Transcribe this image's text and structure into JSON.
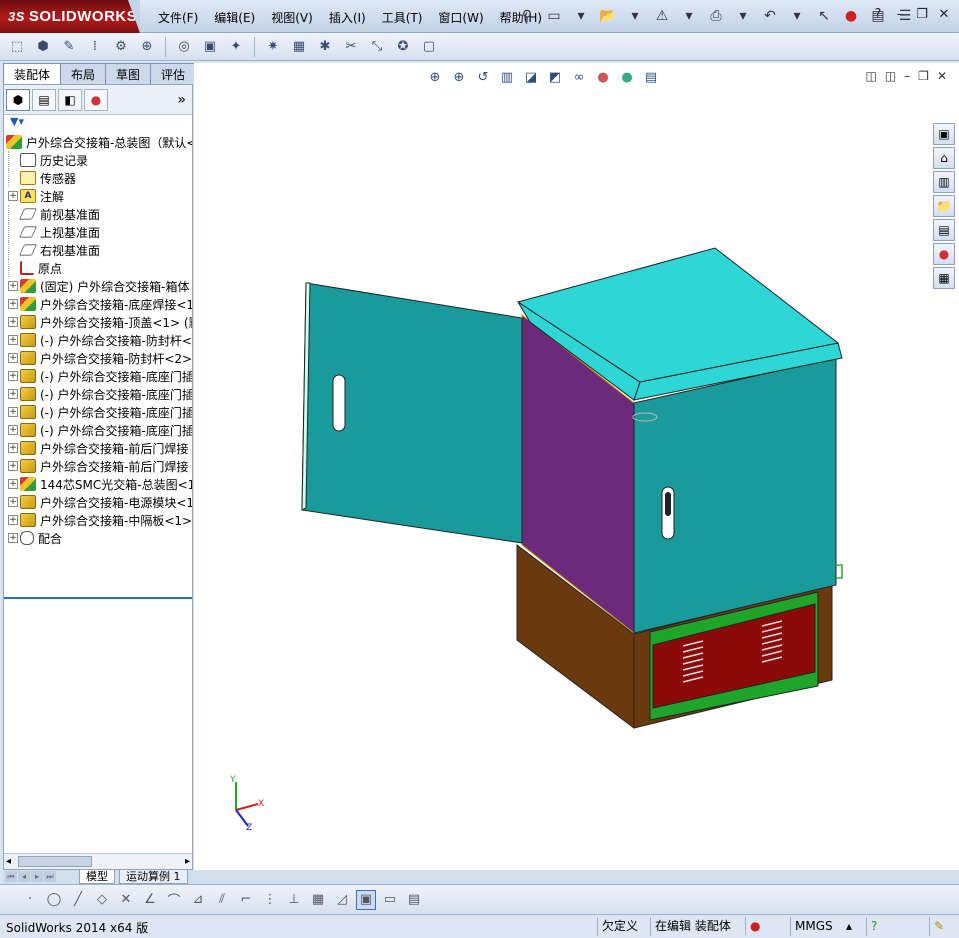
{
  "app": {
    "logo_ds": "3S",
    "logo_text": "SOLIDWORKS"
  },
  "menu": [
    "文件(F)",
    "编辑(E)",
    "视图(V)",
    "插入(I)",
    "工具(T)",
    "窗口(W)",
    "帮助(H)"
  ],
  "left_tabs": [
    "装配体",
    "布局",
    "草图",
    "评估"
  ],
  "tree": {
    "root": "户外综合交接箱-总装图（默认<",
    "items": [
      {
        "label": "历史记录",
        "icon": "history-icon",
        "expand": false
      },
      {
        "label": "传感器",
        "icon": "sensor-icon",
        "expand": false
      },
      {
        "label": "注解",
        "icon": "annotation-icon",
        "expand": true
      },
      {
        "label": "前视基准面",
        "icon": "plane-icon",
        "expand": false
      },
      {
        "label": "上视基准面",
        "icon": "plane-icon",
        "expand": false
      },
      {
        "label": "右视基准面",
        "icon": "plane-icon",
        "expand": false
      },
      {
        "label": "原点",
        "icon": "origin-icon",
        "expand": false
      },
      {
        "label": "(固定) 户外综合交接箱-箱体",
        "icon": "assembly-icon",
        "expand": true
      },
      {
        "label": "户外综合交接箱-底座焊接<1>",
        "icon": "assembly-icon",
        "expand": true
      },
      {
        "label": "户外综合交接箱-顶盖<1> (默",
        "icon": "part-icon",
        "expand": true
      },
      {
        "label": "(-) 户外综合交接箱-防封杆<",
        "icon": "part-icon",
        "expand": true
      },
      {
        "label": "户外综合交接箱-防封杆<2>",
        "icon": "part-icon",
        "expand": true
      },
      {
        "label": "(-) 户外综合交接箱-底座门插",
        "icon": "part-icon",
        "expand": true
      },
      {
        "label": "(-) 户外综合交接箱-底座门插",
        "icon": "part-icon",
        "expand": true
      },
      {
        "label": "(-) 户外综合交接箱-底座门插",
        "icon": "part-icon",
        "expand": true
      },
      {
        "label": "(-) 户外综合交接箱-底座门插",
        "icon": "part-icon",
        "expand": true
      },
      {
        "label": "户外综合交接箱-前后门焊接",
        "icon": "part-icon",
        "expand": true
      },
      {
        "label": "户外综合交接箱-前后门焊接",
        "icon": "part-icon",
        "expand": true
      },
      {
        "label": "144芯SMC光交箱-总装图<1>",
        "icon": "assembly-icon",
        "expand": true
      },
      {
        "label": "户外综合交接箱-电源模块<1>",
        "icon": "part-icon",
        "expand": true
      },
      {
        "label": "户外综合交接箱-中隔板<1>",
        "icon": "part-icon",
        "expand": true
      },
      {
        "label": "配合",
        "icon": "mate-icon",
        "expand": true
      }
    ]
  },
  "bottom_tabs": [
    "模型",
    "运动算例 1"
  ],
  "status": {
    "app_version": "SolidWorks 2014 x64 版",
    "definition": "欠定义",
    "editing": "在编辑 装配体",
    "units": "MMGS",
    "units_arrow": "▴",
    "help": "?"
  },
  "triad": {
    "x": "X",
    "y": "Y",
    "z": "Z"
  },
  "colors": {
    "cabinet_teal": "#1a9a9a",
    "top_cyan": "#2ed6d6",
    "side_purple": "#6b2a7a",
    "base_brown": "#6a3a0e",
    "vent_red": "#8b0a0a",
    "strip_green": "#1fa62a"
  }
}
